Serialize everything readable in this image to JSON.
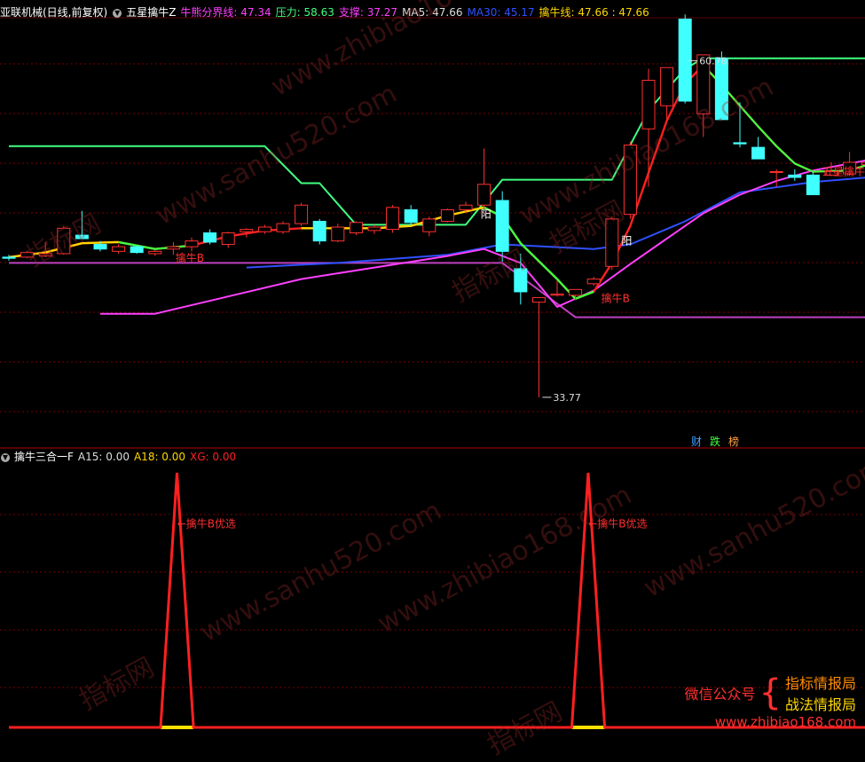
{
  "header_main": {
    "stock": "亚联机械(日线,前复权)",
    "indicator": "五星擒牛Z",
    "items": [
      {
        "label": "牛熊分界线:",
        "value": "47.34",
        "color": "#ff40ff"
      },
      {
        "label": "压力:",
        "value": "58.63",
        "color": "#40ff80"
      },
      {
        "label": "支撑:",
        "value": "37.27",
        "color": "#ff40ff"
      },
      {
        "label": "MA5:",
        "value": "47.66",
        "color": "#dddddd"
      },
      {
        "label": "MA30:",
        "value": "45.17",
        "color": "#3050ff"
      },
      {
        "label": "擒牛线:",
        "value": "47.66 : 47.66",
        "color": "#ffd700"
      }
    ]
  },
  "header_sub": {
    "indicator": "擒牛三合一F",
    "items": [
      {
        "label": "A15:",
        "value": "0.00",
        "color": "#dddddd"
      },
      {
        "label": "A18:",
        "value": "0.00",
        "color": "#ffd700"
      },
      {
        "label": "XG:",
        "value": "0.00",
        "color": "#ff2020"
      }
    ]
  },
  "chart_data": [
    {
      "type": "candlestick",
      "ylim": [
        30,
        66
      ],
      "max_label": "60.78",
      "min_label": "33.77",
      "candles": [
        {
          "o": 45.9,
          "h": 46.1,
          "l": 45.6,
          "c": 45.8
        },
        {
          "o": 45.9,
          "h": 46.4,
          "l": 45.8,
          "c": 46.3
        },
        {
          "o": 46.0,
          "h": 47.2,
          "l": 45.9,
          "c": 46.2
        },
        {
          "o": 46.2,
          "h": 48.6,
          "l": 46.1,
          "c": 48.4
        },
        {
          "o": 47.8,
          "h": 49.9,
          "l": 47.5,
          "c": 47.5
        },
        {
          "o": 47.0,
          "h": 47.3,
          "l": 46.4,
          "c": 46.6
        },
        {
          "o": 46.4,
          "h": 47.0,
          "l": 46.2,
          "c": 46.8
        },
        {
          "o": 46.8,
          "h": 46.9,
          "l": 46.2,
          "c": 46.3
        },
        {
          "o": 46.2,
          "h": 46.5,
          "l": 46.0,
          "c": 46.4
        },
        {
          "o": 46.6,
          "h": 47.2,
          "l": 46.1,
          "c": 46.8
        },
        {
          "o": 46.8,
          "h": 47.6,
          "l": 46.4,
          "c": 47.3
        },
        {
          "o": 48.0,
          "h": 48.3,
          "l": 47.0,
          "c": 47.2
        },
        {
          "o": 47.0,
          "h": 48.1,
          "l": 46.7,
          "c": 48.0
        },
        {
          "o": 48.1,
          "h": 48.4,
          "l": 47.6,
          "c": 48.3
        },
        {
          "o": 48.1,
          "h": 48.7,
          "l": 47.9,
          "c": 48.5
        },
        {
          "o": 48.1,
          "h": 49.0,
          "l": 47.9,
          "c": 48.8
        },
        {
          "o": 48.8,
          "h": 50.6,
          "l": 48.6,
          "c": 50.4
        },
        {
          "o": 49.0,
          "h": 49.2,
          "l": 47.0,
          "c": 47.3
        },
        {
          "o": 47.3,
          "h": 48.8,
          "l": 47.2,
          "c": 48.5
        },
        {
          "o": 48.0,
          "h": 49.0,
          "l": 47.8,
          "c": 48.9
        },
        {
          "o": 48.2,
          "h": 48.7,
          "l": 47.9,
          "c": 48.5
        },
        {
          "o": 48.3,
          "h": 50.4,
          "l": 48.0,
          "c": 50.2
        },
        {
          "o": 50.0,
          "h": 50.4,
          "l": 48.6,
          "c": 48.9
        },
        {
          "o": 48.1,
          "h": 49.4,
          "l": 47.7,
          "c": 49.2
        },
        {
          "o": 49.0,
          "h": 50.1,
          "l": 48.9,
          "c": 50.0
        },
        {
          "o": 50.0,
          "h": 50.7,
          "l": 49.7,
          "c": 50.4
        },
        {
          "o": 50.4,
          "h": 55.3,
          "l": 50.1,
          "c": 52.2
        },
        {
          "o": 50.8,
          "h": 51.6,
          "l": 45.5,
          "c": 46.4
        },
        {
          "o": 44.9,
          "h": 46.2,
          "l": 41.8,
          "c": 42.9
        },
        {
          "o": 42.0,
          "h": 42.4,
          "l": 33.77,
          "c": 42.4
        },
        {
          "o": 42.6,
          "h": 43.9,
          "l": 42.5,
          "c": 42.7
        },
        {
          "o": 42.6,
          "h": 43.1,
          "l": 42.2,
          "c": 43.1
        },
        {
          "o": 43.6,
          "h": 44.2,
          "l": 43.4,
          "c": 44.0
        },
        {
          "o": 45.1,
          "h": 49.4,
          "l": 44.8,
          "c": 49.2
        },
        {
          "o": 49.6,
          "h": 55.9,
          "l": 49.2,
          "c": 55.6
        },
        {
          "o": 57.0,
          "h": 62.2,
          "l": 52.0,
          "c": 61.2
        },
        {
          "o": 59.0,
          "h": 62.3,
          "l": 57.7,
          "c": 62.3
        },
        {
          "o": 66.5,
          "h": 66.9,
          "l": 59.2,
          "c": 59.4
        },
        {
          "o": 58.3,
          "h": 63.4,
          "l": 56.3,
          "c": 63.4
        },
        {
          "o": 63.1,
          "h": 63.7,
          "l": 57.8,
          "c": 57.8
        },
        {
          "o": 55.8,
          "h": 59.3,
          "l": 55.4,
          "c": 55.7
        },
        {
          "o": 55.4,
          "h": 56.3,
          "l": 54.4,
          "c": 54.4
        },
        {
          "o": 53.3,
          "h": 53.5,
          "l": 52.0,
          "c": 53.3
        },
        {
          "o": 53.0,
          "h": 53.5,
          "l": 52.5,
          "c": 52.8
        },
        {
          "o": 53.0,
          "h": 53.3,
          "l": 51.3,
          "c": 51.3
        },
        {
          "o": 53.0,
          "h": 54.1,
          "l": 52.9,
          "c": 53.3
        },
        {
          "o": 53.1,
          "h": 55.0,
          "l": 52.9,
          "c": 54.1
        },
        {
          "o": 53.9,
          "h": 55.4,
          "l": 53.7,
          "c": 54.1
        }
      ],
      "series": [
        {
          "name": "压力",
          "color": "#40ff80",
          "values": [
            {
              "i": 0,
              "v": 55.5
            },
            {
              "i": 14,
              "v": 55.5
            },
            {
              "i": 16,
              "v": 52.3
            },
            {
              "i": 17,
              "v": 52.3
            },
            {
              "i": 19,
              "v": 48.7
            },
            {
              "i": 25,
              "v": 48.7
            },
            {
              "i": 27,
              "v": 52.6
            },
            {
              "i": 33,
              "v": 52.6
            },
            {
              "i": 35,
              "v": 58.6
            },
            {
              "i": 37,
              "v": 62.2
            },
            {
              "i": 38,
              "v": 63.1
            },
            {
              "i": 47,
              "v": 63.1
            }
          ]
        },
        {
          "name": "支撑",
          "color": "#c040c0",
          "values": [
            {
              "i": 0,
              "v": 45.4
            },
            {
              "i": 27,
              "v": 45.4
            },
            {
              "i": 31,
              "v": 40.7
            },
            {
              "i": 47,
              "v": 40.7
            }
          ]
        },
        {
          "name": "MA30",
          "color": "#3050ff",
          "values": [
            {
              "i": 13,
              "v": 45.0
            },
            {
              "i": 18,
              "v": 45.4
            },
            {
              "i": 24,
              "v": 46.1
            },
            {
              "i": 27,
              "v": 47.0
            },
            {
              "i": 32,
              "v": 46.6
            },
            {
              "i": 34,
              "v": 47.0
            },
            {
              "i": 37,
              "v": 49.0
            },
            {
              "i": 40,
              "v": 51.5
            },
            {
              "i": 44,
              "v": 52.4
            },
            {
              "i": 47,
              "v": 52.8
            }
          ]
        },
        {
          "name": "牛熊分界线",
          "color": "#ff40ff",
          "values": [
            {
              "i": 5,
              "v": 41.0
            },
            {
              "i": 8,
              "v": 41.0
            },
            {
              "i": 12,
              "v": 42.5
            },
            {
              "i": 16,
              "v": 44.0
            },
            {
              "i": 20,
              "v": 45.0
            },
            {
              "i": 24,
              "v": 46.0
            },
            {
              "i": 26,
              "v": 46.6
            },
            {
              "i": 28,
              "v": 45.4
            },
            {
              "i": 30,
              "v": 41.6
            },
            {
              "i": 32,
              "v": 43.0
            },
            {
              "i": 34,
              "v": 45.3
            },
            {
              "i": 36,
              "v": 47.5
            },
            {
              "i": 38,
              "v": 49.7
            },
            {
              "i": 40,
              "v": 51.3
            },
            {
              "i": 42,
              "v": 52.5
            },
            {
              "i": 44,
              "v": 53.4
            },
            {
              "i": 47,
              "v": 54.3
            }
          ]
        },
        {
          "name": "擒牛线",
          "color": "#ff2020",
          "values": [
            {
              "i": 0,
              "v": 45.9
            },
            {
              "i": 2,
              "v": 46.3
            },
            {
              "i": 4,
              "v": 47.1
            },
            {
              "i": 6,
              "v": 47.2
            },
            {
              "i": 8,
              "v": 46.6
            },
            {
              "i": 10,
              "v": 46.9
            },
            {
              "i": 12,
              "v": 47.7
            },
            {
              "i": 14,
              "v": 48.2
            },
            {
              "i": 16,
              "v": 48.4
            },
            {
              "i": 18,
              "v": 48.4
            },
            {
              "i": 20,
              "v": 48.4
            },
            {
              "i": 22,
              "v": 48.6
            },
            {
              "i": 24,
              "v": 49.5
            },
            {
              "i": 26,
              "v": 50.2
            },
            {
              "i": 27,
              "v": 49.4
            },
            {
              "i": 28,
              "v": 47.1
            },
            {
              "i": 30,
              "v": 44.0
            },
            {
              "i": 31,
              "v": 42.3
            },
            {
              "i": 32,
              "v": 42.9
            },
            {
              "i": 33,
              "v": 45.4
            },
            {
              "i": 34,
              "v": 48.6
            },
            {
              "i": 35,
              "v": 53.2
            },
            {
              "i": 36,
              "v": 57.7
            },
            {
              "i": 37,
              "v": 60.9
            },
            {
              "i": 38,
              "v": 62.5
            },
            {
              "i": 39,
              "v": 60.8
            },
            {
              "i": 40,
              "v": 59.0
            },
            {
              "i": 41,
              "v": 57.2
            },
            {
              "i": 42,
              "v": 55.5
            },
            {
              "i": 43,
              "v": 54.0
            },
            {
              "i": 44,
              "v": 53.3
            },
            {
              "i": 46,
              "v": 53.4
            },
            {
              "i": 47,
              "v": 53.9
            }
          ]
        }
      ],
      "markers": [
        {
          "text": "擒牛B",
          "i": 9.5,
          "v": 45.5,
          "color": "#ff3030"
        },
        {
          "text": "阳",
          "i": 26.2,
          "v": 49.3,
          "color": "#ffffff"
        },
        {
          "text": "擒牛B",
          "i": 32.8,
          "v": 42.0,
          "color": "#ff3030"
        },
        {
          "text": "阳",
          "i": 33.9,
          "v": 47.0,
          "color": "#ffffff"
        },
        {
          "text": "五星擒牛",
          "i": 44.9,
          "v": 53.0,
          "color": "#ff3030"
        }
      ],
      "badges": [
        {
          "text": "财",
          "color": "#40a0ff"
        },
        {
          "text": "跌",
          "color": "#40ff40"
        },
        {
          "text": "榜",
          "color": "#ffa040"
        }
      ]
    },
    {
      "type": "line",
      "ylim": [
        0,
        1
      ],
      "series": [
        {
          "name": "XG",
          "color": "#ff2020",
          "values": [
            {
              "i": 0,
              "v": 0
            },
            {
              "i": 8.3,
              "v": 0
            },
            {
              "i": 9.2,
              "v": 1
            },
            {
              "i": 10.1,
              "v": 0
            },
            {
              "i": 30.8,
              "v": 0
            },
            {
              "i": 31.7,
              "v": 1
            },
            {
              "i": 32.6,
              "v": 0
            },
            {
              "i": 47.5,
              "v": 0
            }
          ]
        }
      ],
      "baseline_highlight": [
        {
          "from": 8.3,
          "to": 10.1
        },
        {
          "from": 30.8,
          "to": 32.6
        }
      ],
      "highlight_color": "#ffe000",
      "labels": [
        {
          "text": "擒牛B优选",
          "i": 9.6,
          "v": 0.8
        },
        {
          "text": "擒牛B优选",
          "i": 32.1,
          "v": 0.8
        }
      ]
    }
  ],
  "watermarks": {
    "texts": [
      "www.zhibiao168.com",
      "指标网",
      "www.sanhu520.com",
      "指标网",
      "www.zhibiao168.com",
      "指标网",
      "www.sanhu520.com",
      "www.zhibiao168.com",
      "指标网",
      "指标网",
      "www.sanhu520.com"
    ]
  },
  "brand": {
    "label": "微信公众号",
    "brace": "{",
    "names": [
      "指标情报局",
      "战法情报局"
    ],
    "url": "www.zhibiao168.com"
  },
  "colors": {
    "grid": "#7a0000",
    "up": "#ff3030",
    "down": "#40ffff",
    "divider": "#b00000"
  }
}
